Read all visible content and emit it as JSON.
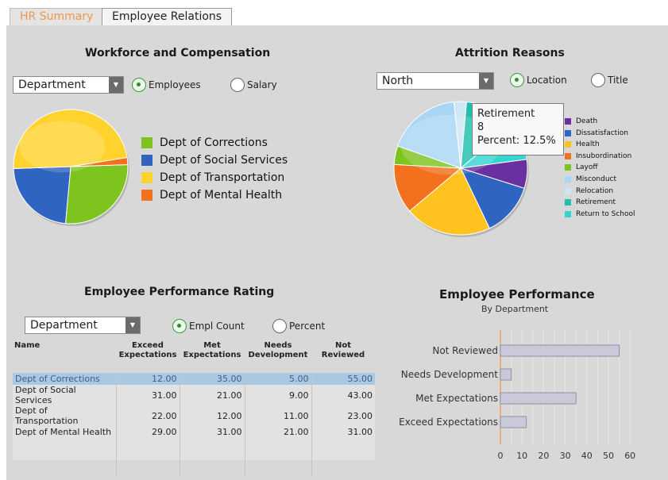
{
  "tabs": [
    {
      "label": "HR Summary",
      "active": true
    },
    {
      "label": "Employee Relations",
      "active": false
    }
  ],
  "workforce": {
    "title": "Workforce and Compensation",
    "dropdown": "Department",
    "radio_employees": "Employees",
    "radio_salary": "Salary",
    "selected": "Employees",
    "legend": [
      {
        "label": "Dept of Corrections",
        "color": "#7ec41e"
      },
      {
        "label": "Dept of Social Services",
        "color": "#2f64c0"
      },
      {
        "label": "Dept of Transportation",
        "color": "#ffd22e"
      },
      {
        "label": "Dept of Mental Health",
        "color": "#f2701e"
      }
    ]
  },
  "attrition": {
    "title": "Attrition Reasons",
    "dropdown": "North",
    "radio_location": "Location",
    "radio_title": "Title",
    "selected": "Location",
    "legend": [
      {
        "label": "Death",
        "color": "#6a2fa0"
      },
      {
        "label": "Dissatisfaction",
        "color": "#2f64c0"
      },
      {
        "label": "Health",
        "color": "#ffc21e"
      },
      {
        "label": "Insubordination",
        "color": "#f2701e"
      },
      {
        "label": "Layoff",
        "color": "#7ec41e"
      },
      {
        "label": "Misconduct",
        "color": "#a9d6f5"
      },
      {
        "label": "Relocation",
        "color": "#cfe6f7"
      },
      {
        "label": "Retirement",
        "color": "#1fbfae"
      },
      {
        "label": "Return to School",
        "color": "#36d6d0"
      }
    ],
    "tooltip": {
      "line1": "Retirement",
      "line2": "8",
      "line3": "Percent: 12.5%"
    }
  },
  "performance_rating": {
    "title": "Employee Performance Rating",
    "dropdown": "Department",
    "radio_count": "Empl Count",
    "radio_percent": "Percent",
    "selected": "Empl Count",
    "headers": {
      "name": "Name",
      "exceed": [
        "Exceed",
        "Expectations"
      ],
      "met": [
        "Met",
        "Expectations"
      ],
      "needs": [
        "Needs",
        "Development"
      ],
      "not": [
        "Not",
        "Reviewed"
      ]
    },
    "rows": [
      {
        "name": "Dept of Corrections",
        "exceed": "12.00",
        "met": "35.00",
        "needs": "5.00",
        "not": "55.00",
        "selected": true
      },
      {
        "name": "Dept of Social Services",
        "exceed": "31.00",
        "met": "21.00",
        "needs": "9.00",
        "not": "43.00"
      },
      {
        "name": "Dept of Transportation",
        "exceed": "22.00",
        "met": "12.00",
        "needs": "11.00",
        "not": "23.00"
      },
      {
        "name": "Dept of Mental Health",
        "exceed": "29.00",
        "met": "31.00",
        "needs": "21.00",
        "not": "31.00"
      }
    ]
  },
  "employee_performance": {
    "title": "Employee Performance",
    "subtitle": "By Department"
  },
  "chart_data": [
    {
      "type": "pie",
      "title": "Workforce and Compensation",
      "categories": [
        "Dept of Corrections",
        "Dept of Social Services",
        "Dept of Transportation",
        "Dept of Mental Health"
      ],
      "values": [
        27,
        23,
        48,
        2
      ],
      "colors": [
        "#7ec41e",
        "#2f64c0",
        "#ffd22e",
        "#f2701e"
      ]
    },
    {
      "type": "pie",
      "title": "Attrition Reasons",
      "categories": [
        "Retirement",
        "Return to School",
        "Death",
        "Dissatisfaction",
        "Health",
        "Insubordination",
        "Layoff",
        "Misconduct",
        "Relocation"
      ],
      "values": [
        12.5,
        9,
        7,
        13,
        21,
        12,
        4.5,
        18,
        3
      ],
      "colors": [
        "#1fbfae",
        "#36d6d0",
        "#6a2fa0",
        "#2f64c0",
        "#ffc21e",
        "#f2701e",
        "#7ec41e",
        "#a9d6f5",
        "#cfe6f7"
      ]
    },
    {
      "type": "bar",
      "orientation": "horizontal",
      "title": "Employee Performance",
      "subtitle": "By Department",
      "categories": [
        "Not Reviewed",
        "Needs Development",
        "Met Expectations",
        "Exceed Expectations"
      ],
      "values": [
        55,
        5,
        35,
        12
      ],
      "xlim": [
        0,
        60
      ],
      "xticks": [
        "0",
        "10",
        "20",
        "30",
        "40",
        "50",
        "60"
      ]
    }
  ]
}
